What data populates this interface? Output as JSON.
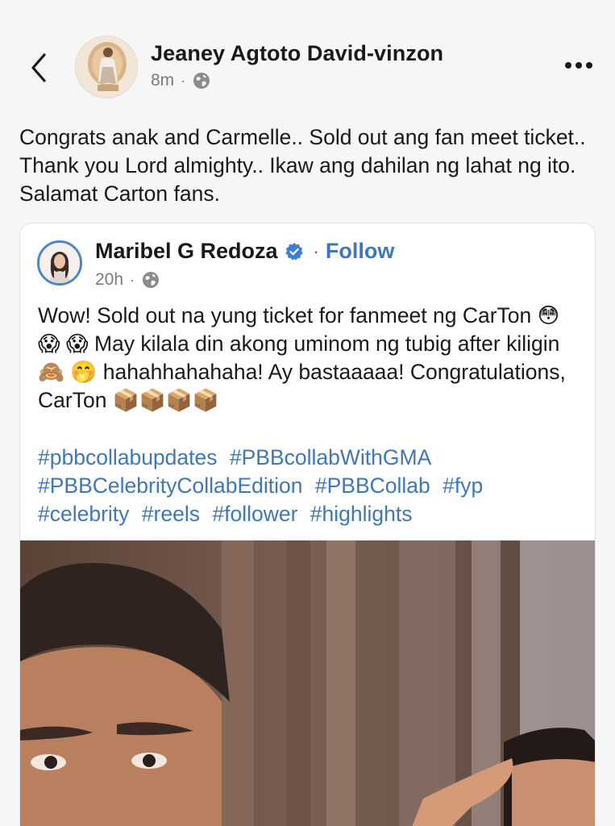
{
  "post": {
    "author": "Jeaney Agtoto David-vinzon",
    "time": "8m",
    "separator": "·",
    "audience_icon": "globe-icon",
    "text": "Congrats anak and Carmelle.. Sold out ang fan meet ticket.. Thank you Lord almighty.. Ikaw ang dahilan ng lahat ng ito. Salamat Carton fans."
  },
  "shared": {
    "author": "Maribel G Redoza",
    "verified_icon": "verified-badge-icon",
    "separator": "·",
    "follow_label": "Follow",
    "time": "20h",
    "audience_icon": "globe-icon",
    "text": "Wow! Sold out na yung ticket for fanmeet ng CarTon 😳 😱 😱 May kilala din akong uminom ng tubig after kiligin 🙈 🤭 hahahhahahaha! Ay bastaaaaa! Congratulations, CarTon 📦📦📦📦",
    "hashtags": [
      "#pbbcollabupdates",
      "#PBBcollabWithGMA",
      "#PBBCelebrityCollabEdition",
      "#PBBCollab",
      "#fyp",
      "#celebrity",
      "#reels",
      "#follower",
      "#highlights"
    ]
  },
  "colors": {
    "link": "#3f78b7",
    "background": "#f7f6f6",
    "card": "#ffffff",
    "text": "#1a1a1a",
    "meta": "#7a7a7a"
  },
  "icons": [
    "back-arrow-icon",
    "more-options-icon",
    "globe-icon",
    "verified-badge-icon"
  ]
}
